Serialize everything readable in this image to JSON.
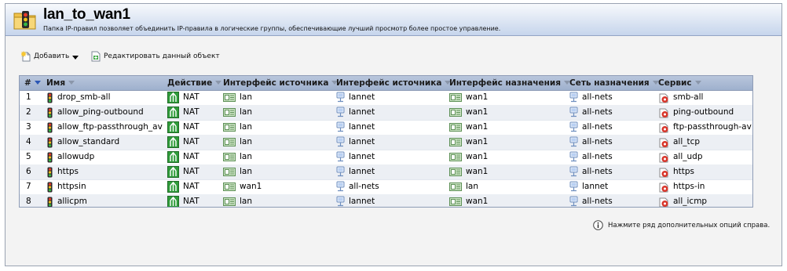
{
  "header": {
    "title": "lan_to_wan1",
    "subtitle": "Папка IP-правил позволяет объединить IP-правила в логические группы, обеспечивающие лучший просмотр более простое управление."
  },
  "toolbar": {
    "add_label": "Добавить",
    "edit_label": "Редактировать данный объект"
  },
  "table": {
    "columns": {
      "num": "#",
      "name": "Имя",
      "action": "Действие",
      "src_iface": "Интерфейс источника",
      "src_net": "Интерфейс источника",
      "dst_iface": "Интерфейс назначения",
      "dst_net": "Сеть назначения",
      "service": "Сервис"
    },
    "rows": [
      {
        "num": "1",
        "name": "drop_smb-all",
        "action": "NAT",
        "src_iface": "lan",
        "src_net": "lannet",
        "dst_iface": "wan1",
        "dst_net": "all-nets",
        "service": "smb-all"
      },
      {
        "num": "2",
        "name": "allow_ping-outbound",
        "action": "NAT",
        "src_iface": "lan",
        "src_net": "lannet",
        "dst_iface": "wan1",
        "dst_net": "all-nets",
        "service": "ping-outbound"
      },
      {
        "num": "3",
        "name": "allow_ftp-passthrough_av",
        "action": "NAT",
        "src_iface": "lan",
        "src_net": "lannet",
        "dst_iface": "wan1",
        "dst_net": "all-nets",
        "service": "ftp-passthrough-av"
      },
      {
        "num": "4",
        "name": "allow_standard",
        "action": "NAT",
        "src_iface": "lan",
        "src_net": "lannet",
        "dst_iface": "wan1",
        "dst_net": "all-nets",
        "service": "all_tcp"
      },
      {
        "num": "5",
        "name": "allowudp",
        "action": "NAT",
        "src_iface": "lan",
        "src_net": "lannet",
        "dst_iface": "wan1",
        "dst_net": "all-nets",
        "service": "all_udp"
      },
      {
        "num": "6",
        "name": "https",
        "action": "NAT",
        "src_iface": "lan",
        "src_net": "lannet",
        "dst_iface": "wan1",
        "dst_net": "all-nets",
        "service": "https"
      },
      {
        "num": "7",
        "name": "httpsin",
        "action": "NAT",
        "src_iface": "wan1",
        "src_net": "all-nets",
        "dst_iface": "lan",
        "dst_net": "lannet",
        "service": "https-in"
      },
      {
        "num": "8",
        "name": "allicpm",
        "action": "NAT",
        "src_iface": "lan",
        "src_net": "lannet",
        "dst_iface": "wan1",
        "dst_net": "all-nets",
        "service": "all_icmp"
      }
    ]
  },
  "footer": {
    "hint": "Нажмите ряд дополнительных опций справа."
  },
  "icons": {
    "folder": "folder-traffic-light-icon",
    "add": "new-item-icon",
    "edit": "edit-object-icon",
    "rule": "traffic-light-icon",
    "action": "nat-icon",
    "interface": "interface-icon",
    "network": "network-object-icon",
    "service": "service-icon",
    "info": "info-icon"
  }
}
